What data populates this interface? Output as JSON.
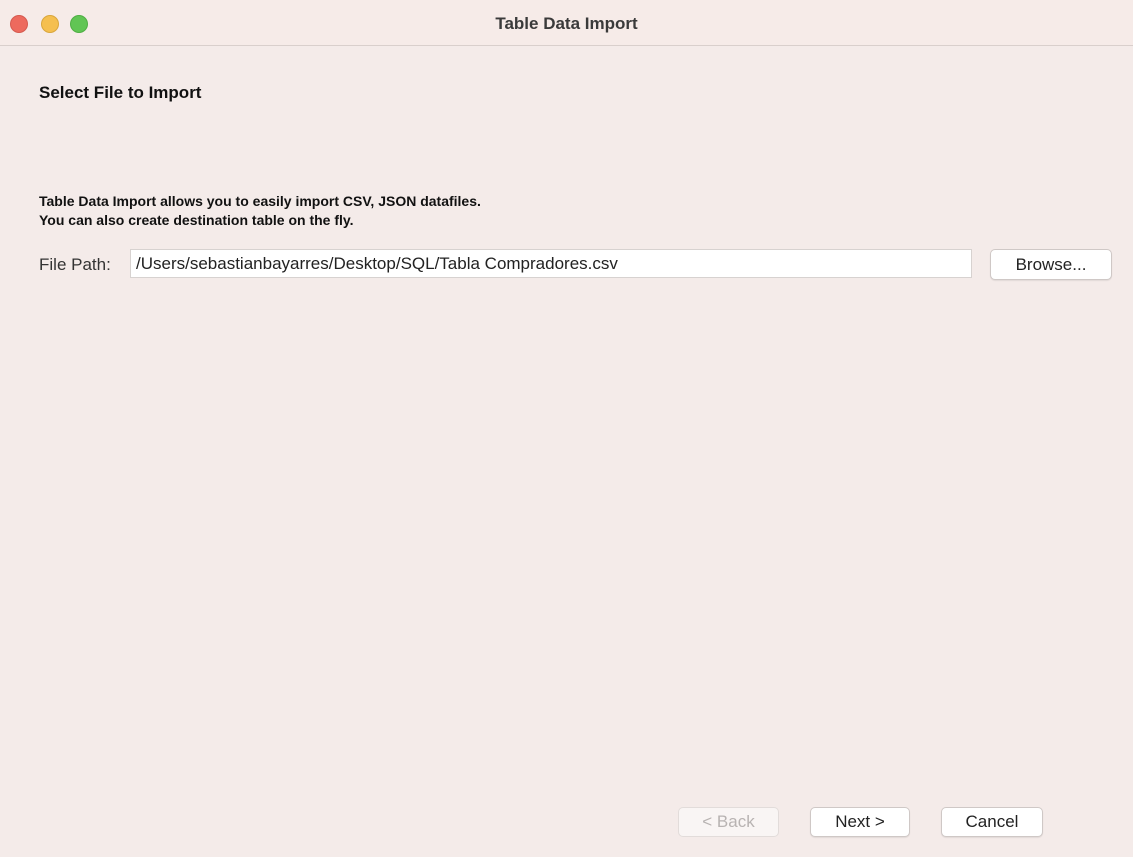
{
  "window": {
    "title": "Table Data Import"
  },
  "wizard": {
    "section_title": "Select File to Import",
    "description_line1": "Table Data Import allows you to easily import CSV, JSON datafiles.",
    "description_line2": "You can also create destination table on the fly.",
    "file_path_label": "File Path:",
    "file_path_value": "/Users/sebastianbayarres/Desktop/SQL/Tabla Compradores.csv",
    "browse_label": "Browse..."
  },
  "footer": {
    "back_label": "< Back",
    "next_label": "Next >",
    "cancel_label": "Cancel"
  },
  "colors": {
    "window_bg": "#f4ebe9",
    "close": "#ed6a5e",
    "minimize": "#f5bf4f",
    "maximize": "#61c554"
  }
}
